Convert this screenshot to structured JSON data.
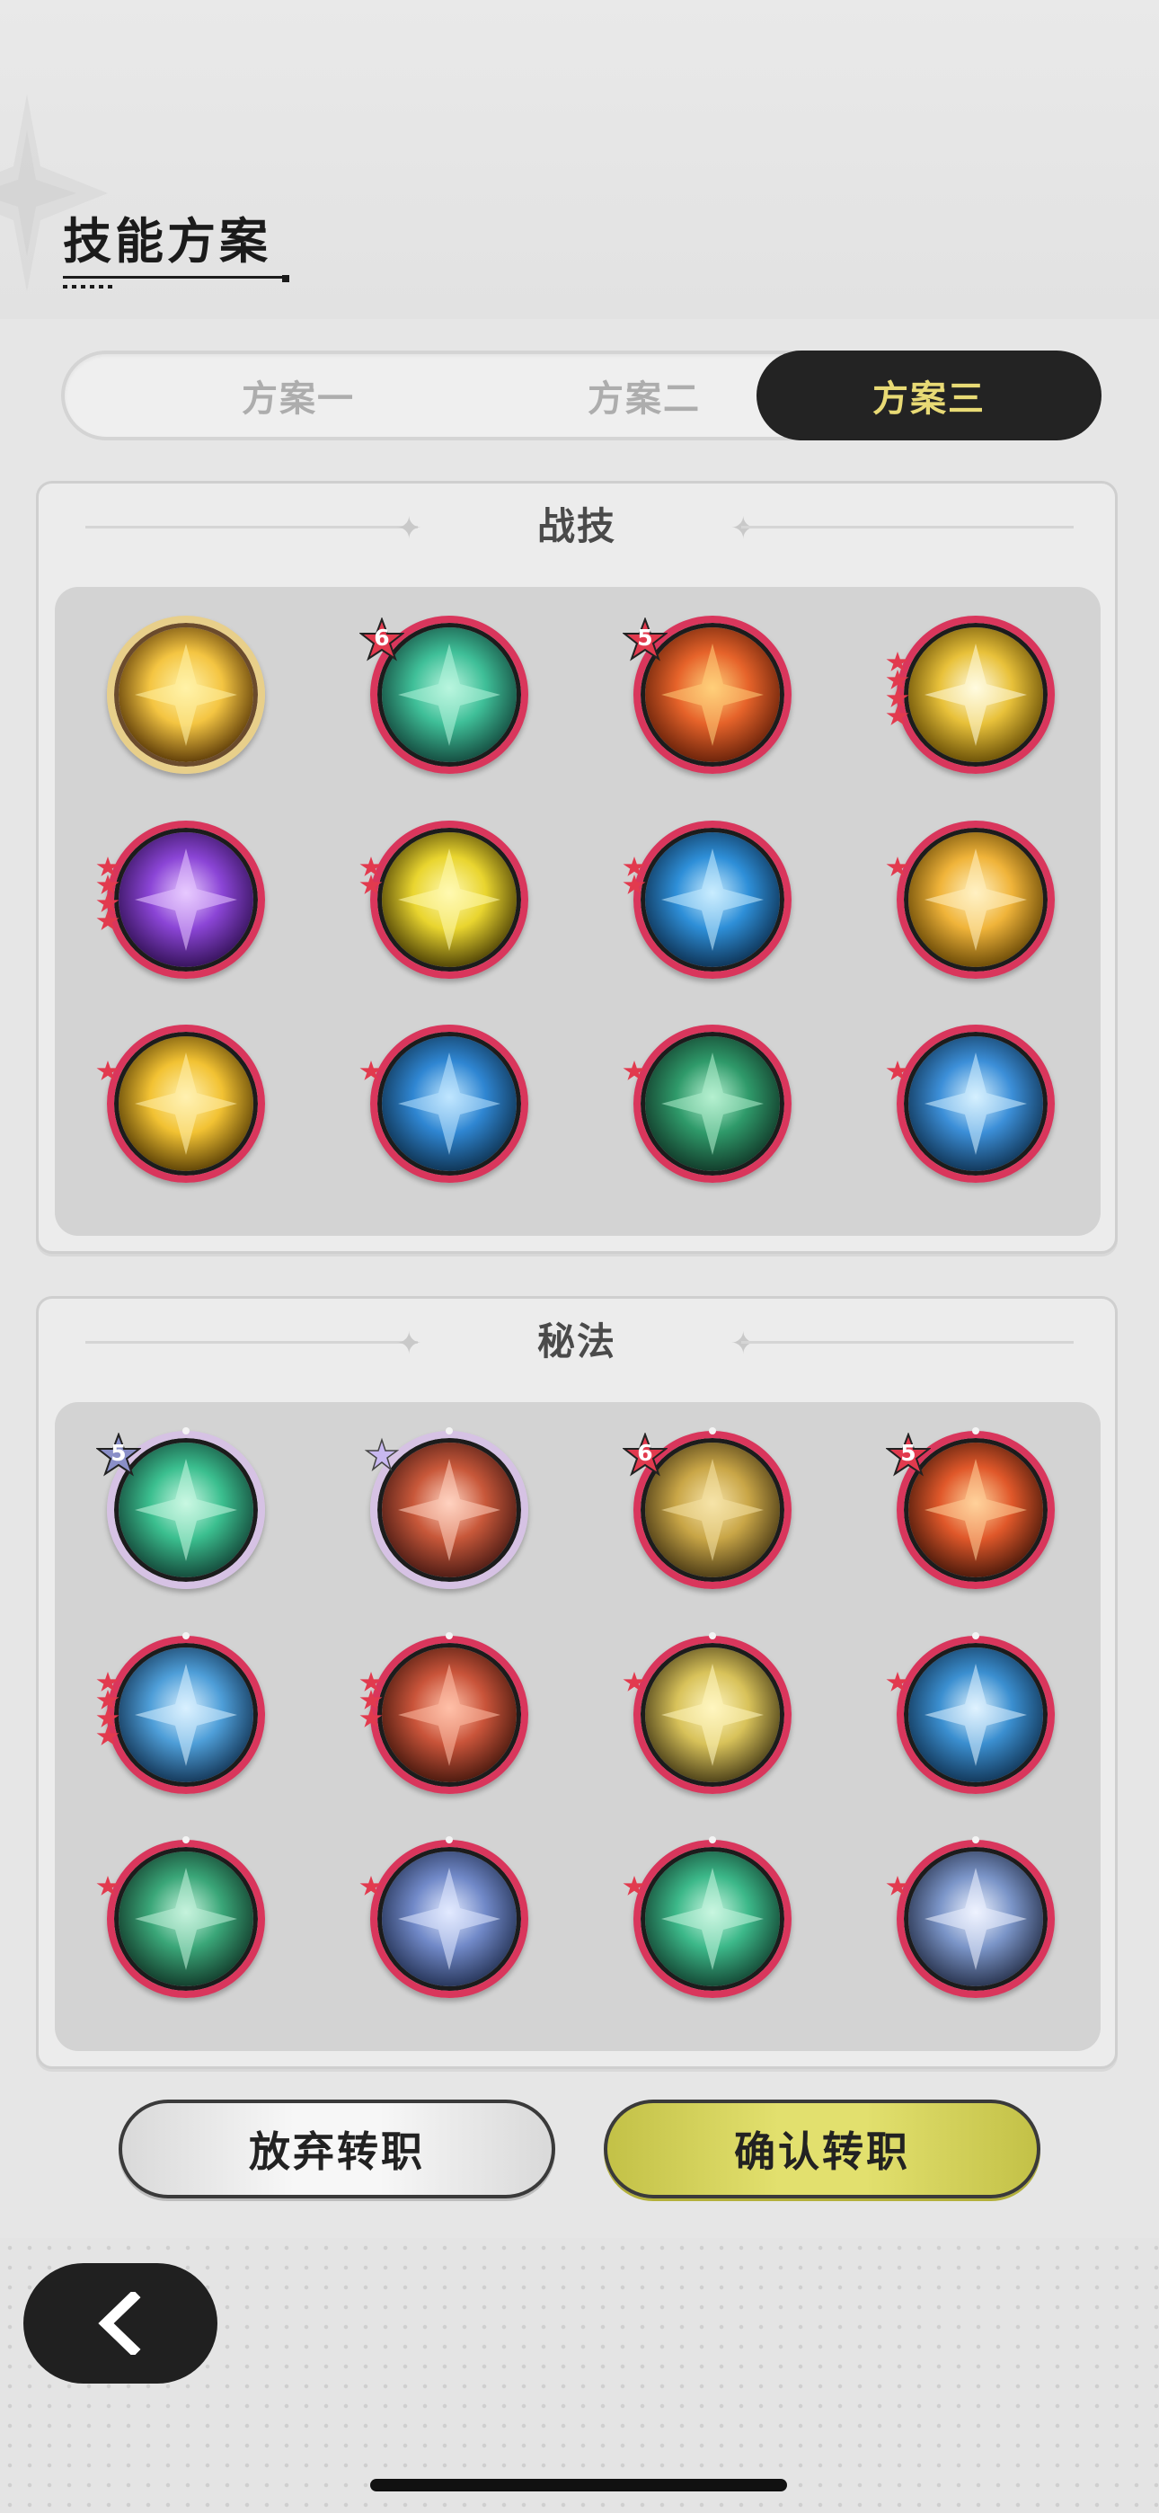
{
  "page_title": "技能方案",
  "tabs": [
    {
      "label": "方案一",
      "selected": false
    },
    {
      "label": "方案二",
      "selected": false
    },
    {
      "label": "方案三",
      "selected": true
    }
  ],
  "combat_skills": {
    "title": "战技",
    "items": [
      {
        "icon": "golden-lightning-burst-icon",
        "frame": "gold",
        "badge": "",
        "stars": 0
      },
      {
        "icon": "green-wind-swirl-icon",
        "frame": "red",
        "badge": "6",
        "stars": 0
      },
      {
        "icon": "fire-explosion-icon",
        "frame": "red",
        "badge": "5",
        "stars": 0
      },
      {
        "icon": "radiant-light-burst-icon",
        "frame": "red",
        "badge": "",
        "stars": 4
      },
      {
        "icon": "purple-arcane-orb-icon",
        "frame": "red",
        "badge": "",
        "stars": 4
      },
      {
        "icon": "yellow-thunder-icon",
        "frame": "red",
        "badge": "",
        "stars": 2
      },
      {
        "icon": "blue-wave-icon",
        "frame": "red",
        "badge": "",
        "stars": 2
      },
      {
        "icon": "golden-shooting-star-icon",
        "frame": "red",
        "badge": "",
        "stars": 1
      },
      {
        "icon": "golden-figure-buff-icon",
        "frame": "red",
        "badge": "",
        "stars": 1
      },
      {
        "icon": "blue-water-blast-icon",
        "frame": "red",
        "badge": "",
        "stars": 1
      },
      {
        "icon": "green-thorn-vine-icon",
        "frame": "red",
        "badge": "",
        "stars": 1
      },
      {
        "icon": "ice-crystal-shard-icon",
        "frame": "red",
        "badge": "",
        "stars": 1
      }
    ]
  },
  "arcane_skills": {
    "title": "秘法",
    "items": [
      {
        "icon": "green-leaf-burst-icon",
        "frame": "holo",
        "badge": "5",
        "stars": 0
      },
      {
        "icon": "red-figure-heal-icon",
        "frame": "holo",
        "badge": "",
        "stars": 0
      },
      {
        "icon": "golden-shield-icon",
        "frame": "red",
        "badge": "6",
        "stars": 0
      },
      {
        "icon": "fire-orb-icon",
        "frame": "red",
        "badge": "5",
        "stars": 0
      },
      {
        "icon": "blue-crystal-icon",
        "frame": "red",
        "badge": "",
        "stars": 4
      },
      {
        "icon": "red-demon-face-icon",
        "frame": "red",
        "badge": "",
        "stars": 3
      },
      {
        "icon": "golden-up-arrow-icon",
        "frame": "red",
        "badge": "",
        "stars": 1
      },
      {
        "icon": "blue-crystal-wave-icon",
        "frame": "red",
        "badge": "",
        "stars": 1
      },
      {
        "icon": "green-heart-icon",
        "frame": "red",
        "badge": "",
        "stars": 1
      },
      {
        "icon": "blue-gem-orb-icon",
        "frame": "red",
        "badge": "",
        "stars": 1
      },
      {
        "icon": "green-gear-orb-icon",
        "frame": "red",
        "badge": "",
        "stars": 1
      },
      {
        "icon": "blue-sparkle-icon",
        "frame": "red",
        "badge": "",
        "stars": 1
      }
    ]
  },
  "buttons": {
    "abandon_label": "放弃转职",
    "confirm_label": "确认转职"
  },
  "colors": {
    "selected_tab_bg": "#232323",
    "selected_tab_text": "#e8da75",
    "confirm_button": "#e2e06e",
    "skill_ring_red": "#d9365c",
    "star_red": "#e23a4e"
  }
}
